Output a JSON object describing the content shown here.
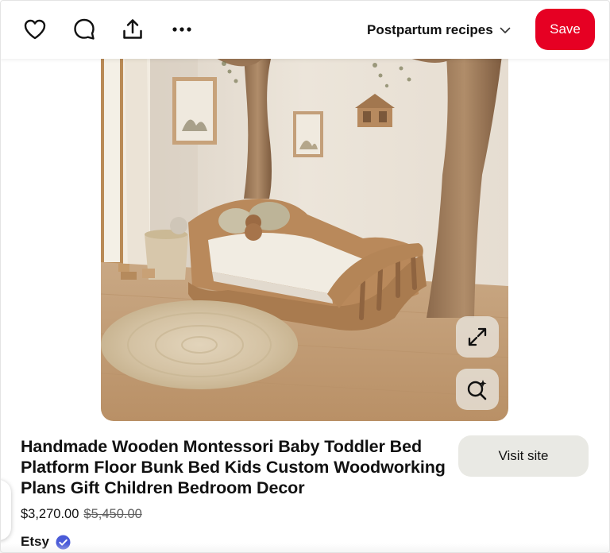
{
  "toolbar": {
    "icons": [
      "heart-icon",
      "comment-icon",
      "share-icon",
      "more-icon"
    ],
    "board_name": "Postpartum recipes",
    "save_label": "Save"
  },
  "pin": {
    "image_description": "Wooden montessori floor bed in a nursery with tree-trunk posts, round jute rug and framed pictures",
    "overlay_buttons": [
      "expand-icon",
      "visual-search-icon"
    ],
    "title": "Handmade Wooden Montessori Baby Toddler Bed Platform Floor Bunk Bed Kids Custom Woodworking Plans Gift Children Bedroom Decor",
    "visit_label": "Visit site",
    "price": "$3,270.00",
    "original_price": "$5,450.00",
    "merchant": "Etsy",
    "merchant_verified": true
  },
  "colors": {
    "save": "#e60023",
    "visit": "#e9e9e4",
    "verified": "#4a5bd8"
  }
}
